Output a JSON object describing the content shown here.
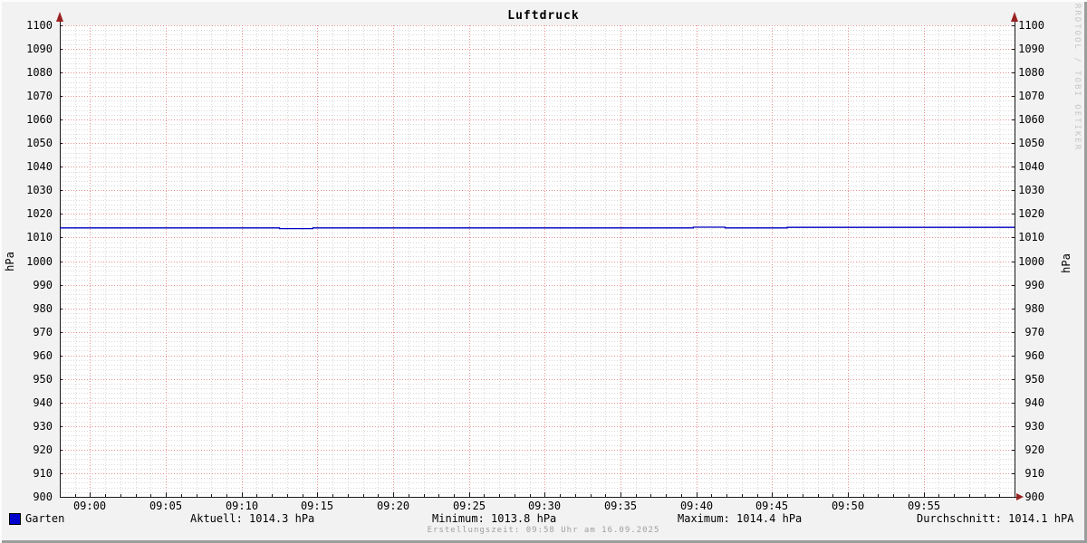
{
  "title": "Luftdruck",
  "watermark": "RRDTOOL / TOBI OETIKER",
  "axis": {
    "left_unit": "hPa",
    "right_unit": "hPa"
  },
  "footer": {
    "legend_label": "Garten",
    "stats": {
      "aktuell": "Aktuell: 1014.3 hPa",
      "minimum": "Minimum: 1013.8 hPa",
      "maximum": "Maximum: 1014.4 hPa",
      "durchschnitt": "Durchschnitt: 1014.1 hPA"
    },
    "creation": "Erstellungszeit: 09:58 Uhr am 16.09.2025"
  },
  "colors": {
    "background": "#f2f2f2",
    "plot_background": "#ffffff",
    "major_grid": "#e89090",
    "minor_grid": "#d9d9d9",
    "axis": "#1a1a1a",
    "arrow": "#992222",
    "series": "#0000c0",
    "swatch": "#0000cc"
  },
  "chart_data": {
    "type": "line",
    "title": "Luftdruck",
    "ylabel": "hPa",
    "ylabel_right": "hPa",
    "ylim": [
      900,
      1100
    ],
    "y_major_step": 10,
    "y_minor_step": 2,
    "y_ticks": [
      1100,
      1090,
      1080,
      1070,
      1060,
      1050,
      1040,
      1030,
      1020,
      1010,
      1000,
      990,
      980,
      970,
      960,
      950,
      940,
      930,
      920,
      910,
      900
    ],
    "x_minutes_range": [
      -2,
      61
    ],
    "x_minor_step_minutes": 1,
    "x_major_ticks": [
      {
        "minute": 0,
        "label": "09:00"
      },
      {
        "minute": 5,
        "label": "09:05"
      },
      {
        "minute": 10,
        "label": "09:10"
      },
      {
        "minute": 15,
        "label": "09:15"
      },
      {
        "minute": 20,
        "label": "09:20"
      },
      {
        "minute": 25,
        "label": "09:25"
      },
      {
        "minute": 30,
        "label": "09:30"
      },
      {
        "minute": 35,
        "label": "09:35"
      },
      {
        "minute": 40,
        "label": "09:40"
      },
      {
        "minute": 45,
        "label": "09:45"
      },
      {
        "minute": 50,
        "label": "09:50"
      },
      {
        "minute": 55,
        "label": "09:55"
      }
    ],
    "grid": true,
    "legend_position": "bottom",
    "series": [
      {
        "name": "Garten",
        "color": "#0000c0",
        "step_points": [
          [
            -2.0,
            1014.1
          ],
          [
            12.5,
            1014.1
          ],
          [
            12.5,
            1013.8
          ],
          [
            14.7,
            1013.8
          ],
          [
            14.7,
            1014.1
          ],
          [
            39.8,
            1014.1
          ],
          [
            39.8,
            1014.4
          ],
          [
            41.9,
            1014.4
          ],
          [
            41.9,
            1014.1
          ],
          [
            46.0,
            1014.1
          ],
          [
            46.0,
            1014.3
          ],
          [
            61.0,
            1014.3
          ]
        ]
      }
    ],
    "stats": {
      "aktuell_hpa": 1014.3,
      "minimum_hpa": 1013.8,
      "maximum_hpa": 1014.4,
      "durchschnitt_hpa": 1014.1
    }
  }
}
